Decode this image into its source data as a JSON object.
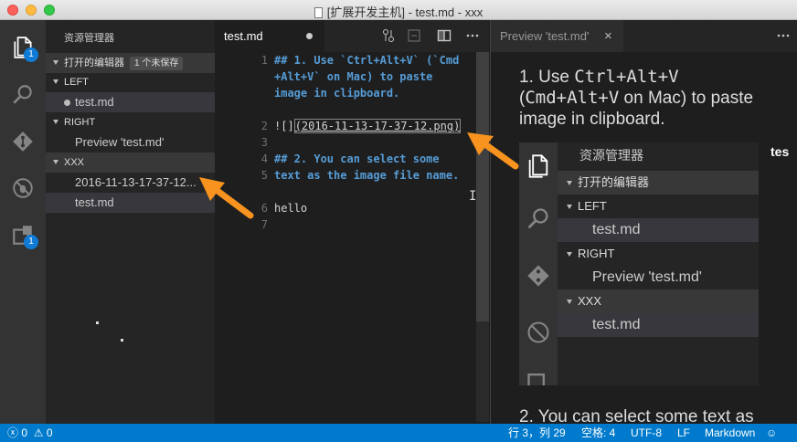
{
  "window": {
    "title": "[扩展开发主机] - test.md - xxx"
  },
  "activity_bar": {
    "badges": [
      "1",
      "1"
    ]
  },
  "sidebar": {
    "title": "资源管理器",
    "open_editors_label": "打开的编辑器",
    "unsaved_badge": "1 个未保存",
    "groups": [
      {
        "label": "LEFT",
        "items": [
          "test.md"
        ]
      },
      {
        "label": "RIGHT",
        "items": [
          "Preview 'test.md'"
        ]
      },
      {
        "label": "XXX",
        "items": [
          "2016-11-13-17-37-12...",
          "test.md"
        ]
      }
    ]
  },
  "editor": {
    "tab_label": "test.md",
    "lines": [
      {
        "num": "1",
        "text": "## 1. Use `Ctrl+Alt+V` (`Cmd"
      },
      {
        "num": "",
        "text": "+Alt+V` on Mac) to paste"
      },
      {
        "num": "",
        "text": "image in clipboard."
      },
      {
        "num": "2",
        "text": ""
      },
      {
        "num": "3",
        "text_prefix": "![]",
        "text_link": "(2016-11-13-17-37-12.png)"
      },
      {
        "num": "4",
        "text": ""
      },
      {
        "num": "5",
        "text": "## 2. You can select some"
      },
      {
        "num": "",
        "text": "text as the image file name."
      },
      {
        "num": "6",
        "text": ""
      },
      {
        "num": "7",
        "text": "hello"
      }
    ]
  },
  "preview": {
    "tab_label": "Preview 'test.md'",
    "close_glyph": "×",
    "para1_prefix": "1. Use ",
    "para1_code1": "Ctrl+Alt+V",
    "para1_mid": "(",
    "para1_code2": "Cmd+Alt+V",
    "para1_suffix": " on Mac) to paste",
    "para1_line3": "image in clipboard.",
    "image": {
      "title": "资源管理器",
      "open_editors_label": "打开的编辑器",
      "cut_text": "tes",
      "groups": [
        {
          "label": "LEFT",
          "items": [
            "test.md"
          ]
        },
        {
          "label": "RIGHT",
          "items": [
            "Preview 'test.md'"
          ]
        },
        {
          "label": "XXX",
          "items": [
            "test.md"
          ]
        }
      ]
    },
    "para2": "2. You can select some text as"
  },
  "status_bar": {
    "errors": "0",
    "warnings": "0",
    "position": "行 3，列 29",
    "spaces": "空格: 4",
    "encoding": "UTF-8",
    "eol": "LF",
    "language": "Markdown"
  },
  "colors": {
    "accent": "#007acc",
    "arrow": "#f7931e",
    "heading": "#569cd6"
  }
}
